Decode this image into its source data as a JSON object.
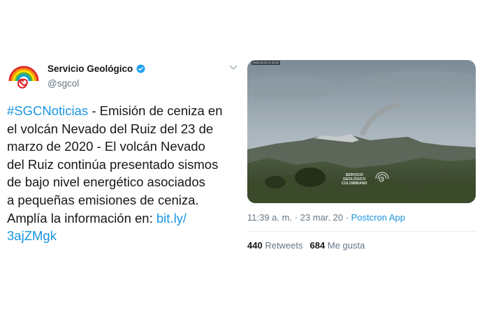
{
  "author": {
    "name": "Servicio Geológico",
    "handle": "@sgcol",
    "avatar_icon": "sgc-rainbow-spiral-logo",
    "verified_icon": "verified-badge-icon"
  },
  "tweet": {
    "hashtag": "#SGCNoticias",
    "line1_rest": " - Emisión de ceniza en",
    "line2": "el volcán Nevado del Ruiz del 23 de",
    "line3": "marzo de 2020 - El volcán Nevado",
    "line4": "del Ruiz continúa presentado sismos",
    "line5": "de bajo nivel energético asociados",
    "line6": "a pequeñas emisiones de ceniza.",
    "line7_prefix": "Amplía la información en: ",
    "link_part1": "bit.ly/",
    "link_part2": "3ajZMgk"
  },
  "media": {
    "watermark_line1": "SERVICIO",
    "watermark_line2": "GEOLÓGICO",
    "watermark_line3": "COLOMBIANO",
    "camera_stamp": "2020-03-23 11:31:53"
  },
  "meta": {
    "time": "11:39 a. m.",
    "separator": " · ",
    "date": "23 mar. 20",
    "app": "Postcron App"
  },
  "stats": {
    "retweets_count": "440",
    "retweets_label": "Retweets",
    "likes_count": "684",
    "likes_label": "Me gusta"
  },
  "colors": {
    "link": "#1b95e0",
    "secondary_text": "#657786",
    "primary_text": "#14171a"
  }
}
